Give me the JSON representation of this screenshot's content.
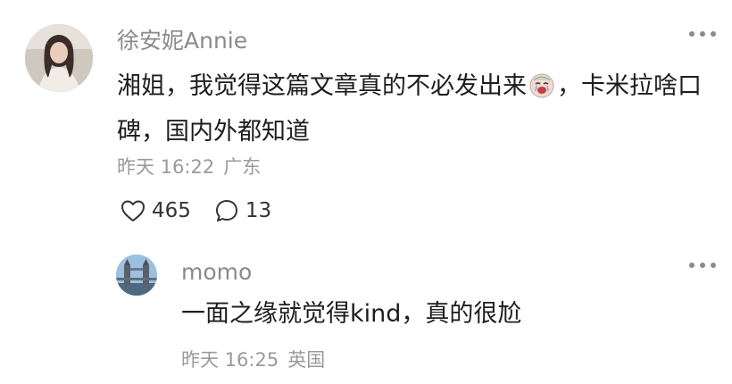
{
  "comment": {
    "username": "徐安妮Annie",
    "text_before_emoji": "湘姐，我觉得这篇文章真的不必发出来",
    "emoji_icon": "crying-face-icon",
    "text_after_emoji": "，卡米拉啥口碑，国内外都知道",
    "time": "昨天 16:22",
    "location": "广东",
    "likes": "465",
    "replies": "13"
  },
  "reply": {
    "username": "momo",
    "text": "一面之缘就觉得kind，真的很尬",
    "time": "昨天 16:25",
    "location": "英国"
  }
}
